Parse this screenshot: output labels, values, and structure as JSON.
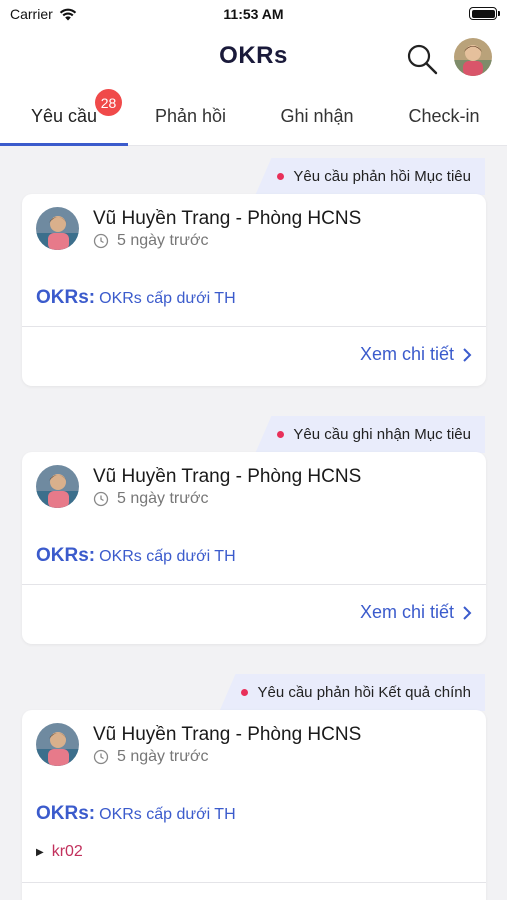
{
  "status": {
    "carrier": "Carrier",
    "time": "11:53 AM"
  },
  "header": {
    "title": "OKRs"
  },
  "tabs": [
    {
      "label": "Yêu cầu",
      "badge": "28"
    },
    {
      "label": "Phản hồi"
    },
    {
      "label": "Ghi nhận"
    },
    {
      "label": "Check-in"
    }
  ],
  "items": [
    {
      "tag": "Yêu cầu phản hồi Mục tiêu",
      "name": "Vũ Huyền Trang - Phòng HCNS",
      "time": "5 ngày trước",
      "okr_label": "OKRs:",
      "okr_value": "OKRs cấp dưới TH",
      "detail": "Xem chi tiết"
    },
    {
      "tag": "Yêu cầu ghi nhận Mục tiêu",
      "name": "Vũ Huyền Trang - Phòng HCNS",
      "time": "5 ngày trước",
      "okr_label": "OKRs:",
      "okr_value": "OKRs cấp dưới TH",
      "detail": "Xem chi tiết"
    },
    {
      "tag": "Yêu cầu phản hồi Kết quả chính",
      "name": "Vũ Huyền Trang - Phòng HCNS",
      "time": "5 ngày trước",
      "okr_label": "OKRs:",
      "okr_value": "OKRs cấp dưới TH",
      "kr": "kr02"
    }
  ],
  "colors": {
    "accent": "#3b5bcc",
    "badge": "#f04a4a",
    "dot": "#e8305a",
    "tag_bg": "#e9ecfb",
    "kr": "#c2305c"
  }
}
